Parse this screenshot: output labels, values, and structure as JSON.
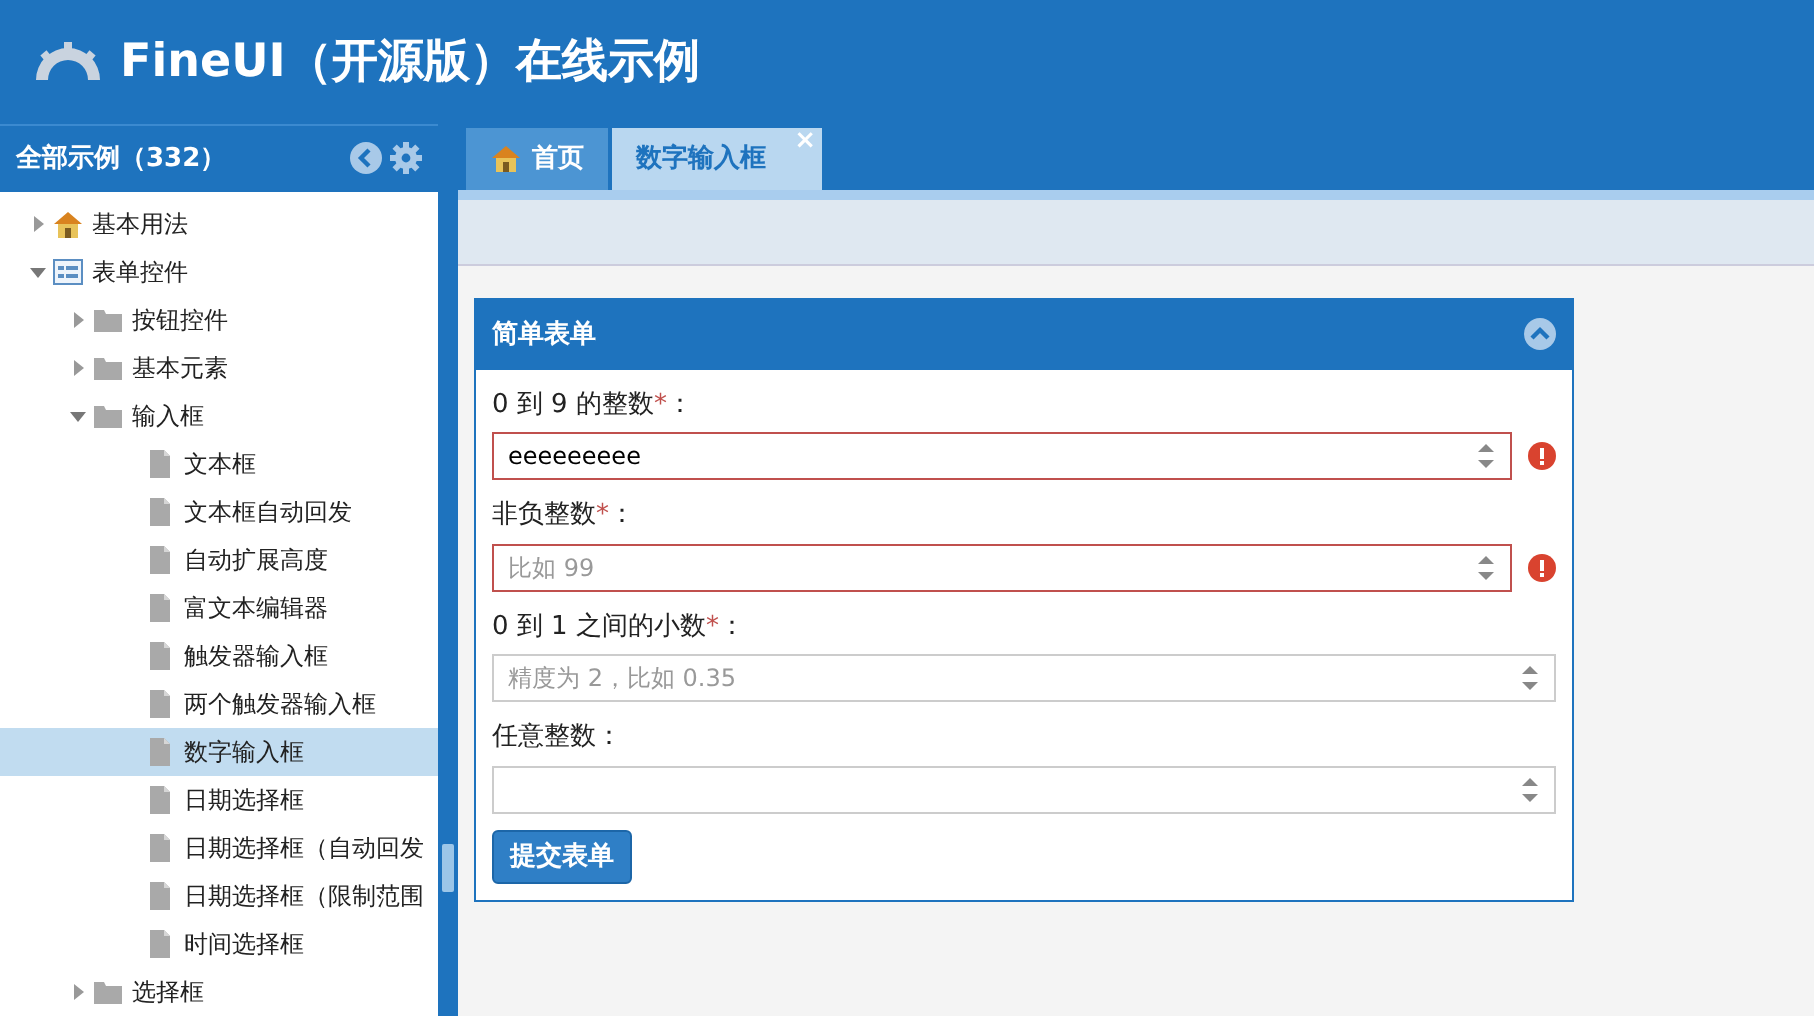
{
  "header": {
    "title": "FineUI（开源版）在线示例"
  },
  "sidebar": {
    "title": "全部示例（332）",
    "tree": [
      {
        "label": "基本用法",
        "kind": "home",
        "expanded": false
      },
      {
        "label": "表单控件",
        "kind": "form",
        "expanded": true,
        "children": [
          {
            "label": "按钮控件",
            "kind": "folder",
            "expanded": false
          },
          {
            "label": "基本元素",
            "kind": "folder",
            "expanded": false
          },
          {
            "label": "输入框",
            "kind": "folder",
            "expanded": true,
            "children": [
              {
                "label": "文本框",
                "kind": "file",
                "selected": false
              },
              {
                "label": "文本框自动回发",
                "kind": "file",
                "selected": false
              },
              {
                "label": "自动扩展高度",
                "kind": "file",
                "selected": false
              },
              {
                "label": "富文本编辑器",
                "kind": "file",
                "selected": false
              },
              {
                "label": "触发器输入框",
                "kind": "file",
                "selected": false
              },
              {
                "label": "两个触发器输入框",
                "kind": "file",
                "selected": false
              },
              {
                "label": "数字输入框",
                "kind": "file",
                "selected": true
              },
              {
                "label": "日期选择框",
                "kind": "file",
                "selected": false
              },
              {
                "label": "日期选择框（自动回发",
                "kind": "file",
                "selected": false
              },
              {
                "label": "日期选择框（限制范围",
                "kind": "file",
                "selected": false
              },
              {
                "label": "时间选择框",
                "kind": "file",
                "selected": false
              }
            ]
          },
          {
            "label": "选择框",
            "kind": "folder",
            "expanded": false
          }
        ]
      }
    ]
  },
  "tabs": [
    {
      "label": "首页",
      "kind": "home",
      "selected": false
    },
    {
      "label": "数字输入框",
      "kind": "page",
      "selected": true,
      "close": "×"
    }
  ],
  "panel": {
    "title": "简单表单",
    "fields": [
      {
        "label": "0 到 9 的整数",
        "required": "*",
        "colon": "：",
        "value": "eeeeeeeee",
        "invalid": true
      },
      {
        "label": "非负整数",
        "required": "*",
        "colon": "：",
        "placeholder": "比如 99",
        "invalid": true
      },
      {
        "label": "0 到 1 之间的小数",
        "required": "*",
        "colon": "：",
        "placeholder": "精度为 2，比如 0.35",
        "invalid": false
      },
      {
        "label": "任意整数",
        "colon": "：",
        "invalid": false
      }
    ],
    "submit": "提交表单"
  }
}
